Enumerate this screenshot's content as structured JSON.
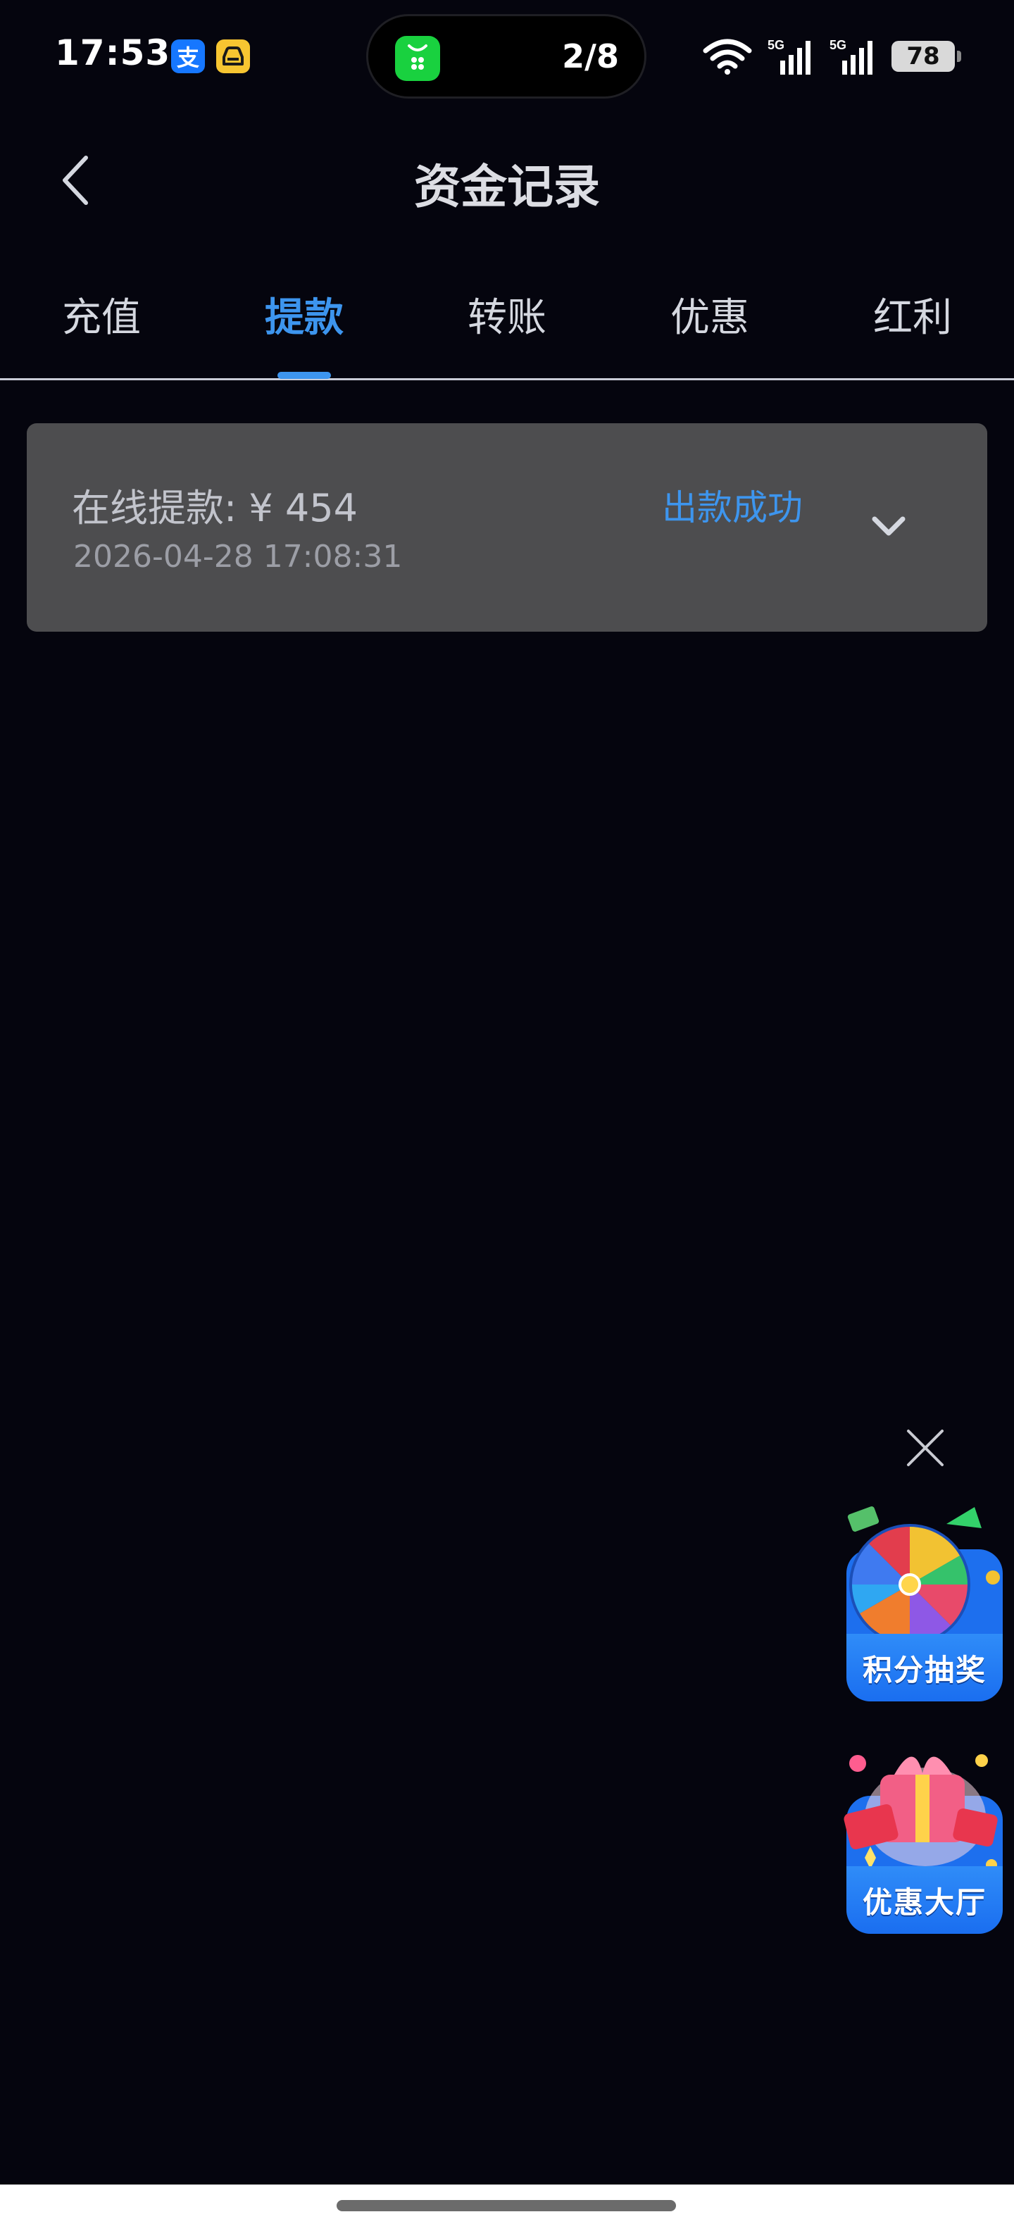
{
  "status_bar": {
    "time": "17:53",
    "alipay_glyph": "支",
    "car_glyph": "⌂",
    "island_counter": "2/8",
    "network_label_1": "5G",
    "network_label_2": "5G",
    "battery": "78"
  },
  "header": {
    "title": "资金记录"
  },
  "tabs": [
    {
      "label": "充值",
      "active": false
    },
    {
      "label": "提款",
      "active": true
    },
    {
      "label": "转账",
      "active": false
    },
    {
      "label": "优惠",
      "active": false
    },
    {
      "label": "红利",
      "active": false
    }
  ],
  "records": [
    {
      "title": "在线提款: ¥ 454",
      "time": "2026-04-28 17:08:31",
      "status": "出款成功"
    }
  ],
  "floating": {
    "lottery_label": "积分抽奖",
    "promo_label": "优惠大厅"
  },
  "colors": {
    "accent": "#3d95ee",
    "background": "#05050e",
    "card": "#4d4d4f"
  },
  "icons": {
    "back": "chevron-left-icon",
    "expand": "chevron-down-icon",
    "close": "close-icon",
    "wifi": "wifi-icon",
    "signal": "signal-icon"
  }
}
